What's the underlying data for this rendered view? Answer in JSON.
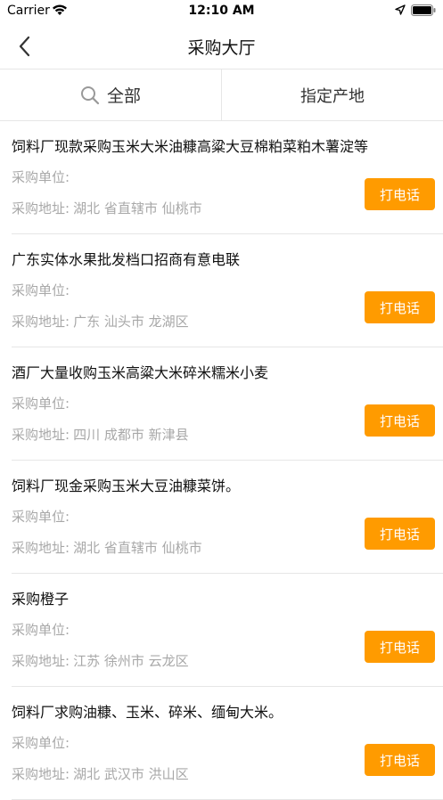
{
  "status": {
    "carrier": "Carrier",
    "time": "12:10 AM"
  },
  "nav": {
    "title": "采购大厅"
  },
  "filters": {
    "all": "全部",
    "origin": "指定产地"
  },
  "labels": {
    "unit": "采购单位:",
    "addr": "采购地址:",
    "call": "打电话"
  },
  "items": [
    {
      "title": "饲料厂现款采购玉米大米油糠高粱大豆棉粕菜粕木薯淀等",
      "address": "湖北 省直辖市 仙桃市"
    },
    {
      "title": "广东实体水果批发档口招商有意电联",
      "address": "广东 汕头市 龙湖区"
    },
    {
      "title": "酒厂大量收购玉米高粱大米碎米糯米小麦",
      "address": "四川 成都市 新津县"
    },
    {
      "title": "饲料厂现金采购玉米大豆油糠菜饼。",
      "address": "湖北 省直辖市 仙桃市"
    },
    {
      "title": "采购橙子",
      "address": "江苏 徐州市 云龙区"
    },
    {
      "title": "饲料厂求购油糠、玉米、碎米、缅甸大米。",
      "address": "湖北 武汉市 洪山区"
    }
  ]
}
